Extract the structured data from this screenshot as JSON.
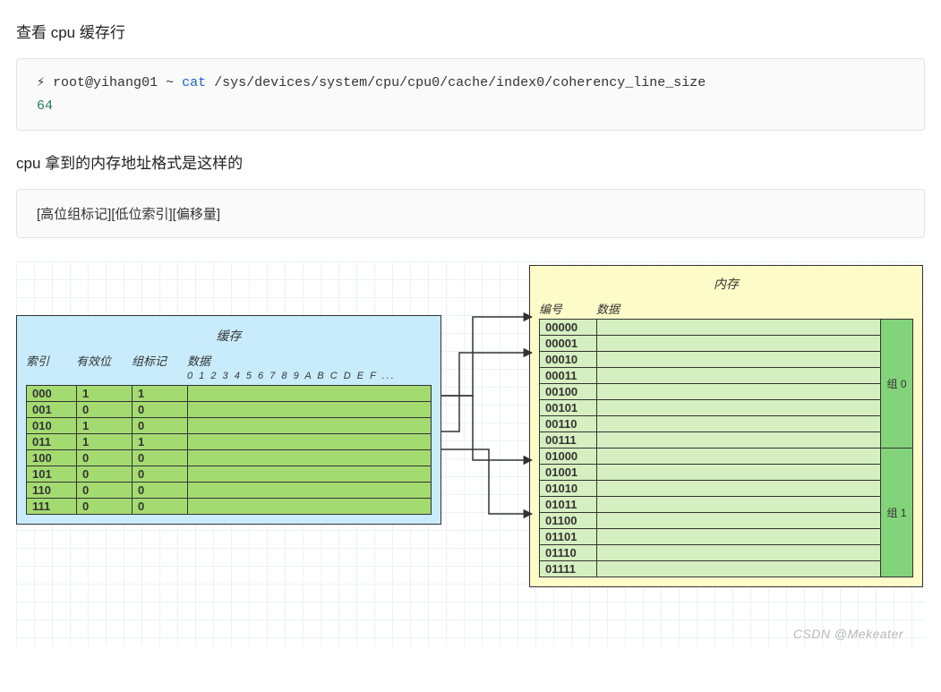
{
  "heading_cacheLine": "查看 cpu 缓存行",
  "code": {
    "prompt_glyph": "⚡",
    "prompt": "root@yihang01 ~",
    "cmd": "cat",
    "path": "/sys/devices/system/cpu/cpu0/cache/index0/coherency_line_size",
    "output": "64"
  },
  "heading_addr": "cpu 拿到的内存地址格式是这样的",
  "addr_format": "[高位组标记][低位索引][偏移量]",
  "cache": {
    "title": "缓存",
    "headers": {
      "index": "索引",
      "valid": "有效位",
      "tag": "组标记",
      "data": "数据"
    },
    "data_cols": "0 1 2 3 4 5 6 7 8 9 A B C D E F ...",
    "rows": [
      {
        "index": "000",
        "valid": "1",
        "tag": "1"
      },
      {
        "index": "001",
        "valid": "0",
        "tag": "0"
      },
      {
        "index": "010",
        "valid": "1",
        "tag": "0"
      },
      {
        "index": "011",
        "valid": "1",
        "tag": "1"
      },
      {
        "index": "100",
        "valid": "0",
        "tag": "0"
      },
      {
        "index": "101",
        "valid": "0",
        "tag": "0"
      },
      {
        "index": "110",
        "valid": "0",
        "tag": "0"
      },
      {
        "index": "111",
        "valid": "0",
        "tag": "0"
      }
    ]
  },
  "memory": {
    "title": "内存",
    "headers": {
      "id": "编号",
      "data": "数据"
    },
    "rows": [
      "00000",
      "00001",
      "00010",
      "00011",
      "00100",
      "00101",
      "00110",
      "00111",
      "01000",
      "01001",
      "01010",
      "01011",
      "01100",
      "01101",
      "01110",
      "01111"
    ],
    "groups": [
      "组 0",
      "组 1"
    ]
  },
  "watermark": "CSDN @Mekeater"
}
